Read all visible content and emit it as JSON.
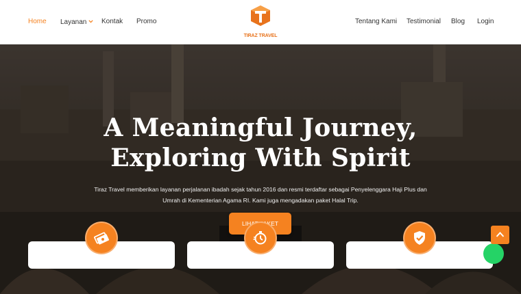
{
  "navbar": {
    "left_items": [
      {
        "label": "Home",
        "active": true
      },
      {
        "label": "Layanan",
        "has_dropdown": true
      },
      {
        "label": "Kontak"
      },
      {
        "label": "Promo"
      }
    ],
    "right_items": [
      {
        "label": "Tentang Kami"
      },
      {
        "label": "Testimonial"
      },
      {
        "label": "Blog"
      },
      {
        "label": "Login"
      }
    ],
    "logo": {
      "text": "TIRAZ TRAVEL",
      "icon": "tiraz-logo-mark"
    }
  },
  "hero": {
    "title_line1": "A Meaningful Journey,",
    "title_line2": "Exploring With Spirit",
    "description": "Tiraz Travel memberikan layanan perjalanan ibadah sejak tahun 2016 dan resmi terdaftar sebagai Penyelenggara Haji Plus dan Umrah di Kementerian Agama RI. Kami juga mengadakan paket Halal Trip.",
    "cta_label": "LIHAT PAKET",
    "background": "mecca-masjid-al-haram-photo"
  },
  "feature_cards": [
    {
      "icon": "money-icon"
    },
    {
      "icon": "stopwatch-icon"
    },
    {
      "icon": "shield-check-icon"
    }
  ],
  "floating": {
    "scroll_top_icon": "chevron-up-icon",
    "chat_icon": "whatsapp-icon"
  },
  "colors": {
    "accent": "#f58220",
    "nav_text": "#333333",
    "hero_text": "#ffffff",
    "chat_green": "#25d366"
  }
}
